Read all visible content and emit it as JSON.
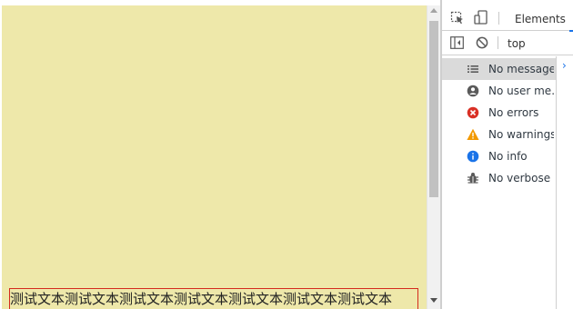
{
  "viewport": {
    "background": "#eee8aa",
    "text_box": {
      "text": "测试文本测试文本测试文本测试文本测试文本测试文本测试文本",
      "border_color": "#d42a1e"
    }
  },
  "devtools": {
    "tabs": [
      {
        "label": "Elements"
      }
    ],
    "toolbar": {
      "context_label": "top"
    },
    "sidebar": {
      "items": [
        {
          "label": "No messages",
          "icon": "list-icon",
          "selected": true
        },
        {
          "label": "No user me...",
          "icon": "user-icon",
          "selected": false
        },
        {
          "label": "No errors",
          "icon": "error-icon",
          "color": "#d93025",
          "selected": false
        },
        {
          "label": "No warnings",
          "icon": "warning-icon",
          "color": "#f29900",
          "selected": false
        },
        {
          "label": "No info",
          "icon": "info-icon",
          "color": "#1a73e8",
          "selected": false
        },
        {
          "label": "No verbose",
          "icon": "bug-icon",
          "selected": false
        }
      ]
    }
  }
}
